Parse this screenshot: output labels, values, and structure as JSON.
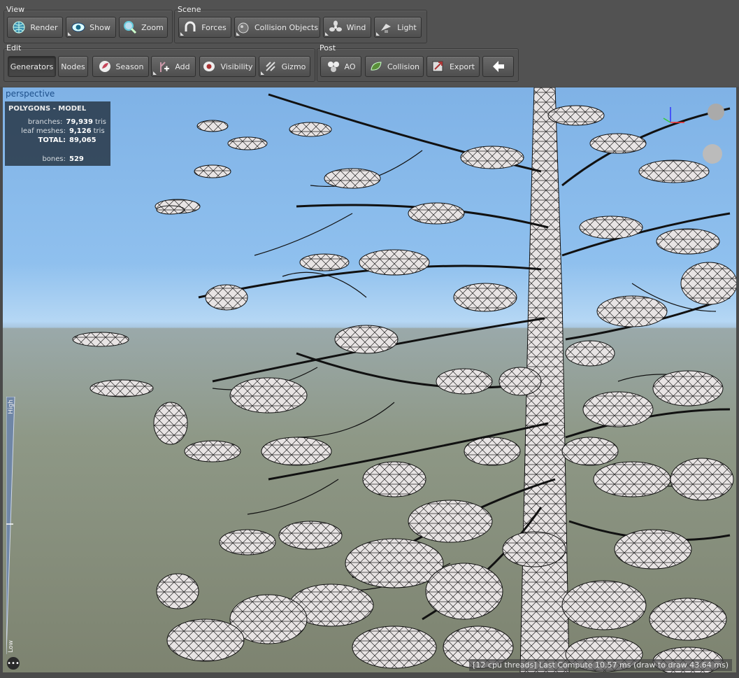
{
  "groups": {
    "view": "View",
    "scene": "Scene",
    "edit": "Edit",
    "post": "Post"
  },
  "buttons": {
    "render": "Render",
    "show": "Show",
    "zoom": "Zoom",
    "forces": "Forces",
    "collision_objects": "Collision Objects",
    "wind": "Wind",
    "light": "Light",
    "generators": "Generators",
    "nodes": "Nodes",
    "season": "Season",
    "add": "Add",
    "visibility": "Visibility",
    "gizmo": "Gizmo",
    "ao": "AO",
    "collision": "Collision",
    "export": "Export"
  },
  "viewport": {
    "label": "perspective"
  },
  "stats": {
    "title": "POLYGONS - MODEL",
    "branches_label": "branches:",
    "branches_value": "79,939",
    "branches_unit": "tris",
    "leaf_label": "leaf meshes:",
    "leaf_value": "9,126",
    "leaf_unit": "tris",
    "total_label": "TOTAL:",
    "total_value": "89,065",
    "bones_label": "bones:",
    "bones_value": "529"
  },
  "lod": {
    "high": "High",
    "low": "Low"
  },
  "status": "[12 cpu threads] Last Compute 10.57 ms (draw to draw 43.64 ms)",
  "menu_dots": "•••"
}
